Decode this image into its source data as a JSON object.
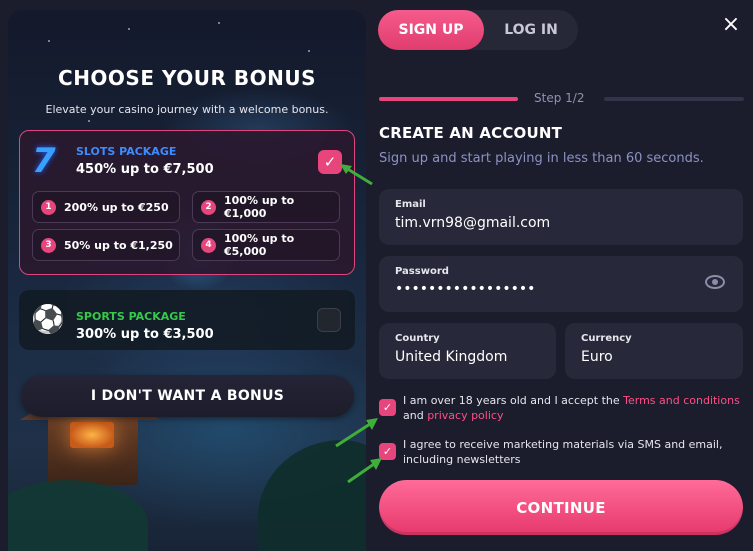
{
  "bonus_panel": {
    "title": "CHOOSE YOUR BONUS",
    "subtitle": "Elevate your casino journey with a welcome bonus.",
    "slots": {
      "icon": "7",
      "name": "SLOTS PACKAGE",
      "offer": "450% up to €7,500",
      "selected": true,
      "tiers": [
        {
          "num": "1",
          "label": "200% up to €250"
        },
        {
          "num": "2",
          "label": "100% up to €1,000"
        },
        {
          "num": "3",
          "label": "50% up to €1,250"
        },
        {
          "num": "4",
          "label": "100% up to €5,000"
        }
      ]
    },
    "sports": {
      "name": "SPORTS PACKAGE",
      "offer": "300% up to €3,500",
      "selected": false
    },
    "no_bonus_label": "I DON'T WANT A BONUS"
  },
  "tabs": {
    "signup": "SIGN UP",
    "login": "LOG IN",
    "active": "signup"
  },
  "close_icon": "×",
  "step": {
    "label": "Step 1/2",
    "current": 1,
    "total": 2
  },
  "form": {
    "title": "CREATE AN ACCOUNT",
    "subtitle": "Sign up and start playing in less than 60 seconds.",
    "email": {
      "label": "Email",
      "value": "tim.vrn98@gmail.com"
    },
    "password": {
      "label": "Password",
      "value": "•••••••••••••••••"
    },
    "country": {
      "label": "Country",
      "value": "United Kingdom"
    },
    "currency": {
      "label": "Currency",
      "value": "Euro"
    },
    "terms": {
      "checked": true,
      "text_before": "I am over 18 years old and I accept the ",
      "terms_link": "Terms and conditions",
      "text_middle": " and ",
      "privacy_link": "privacy policy"
    },
    "marketing": {
      "checked": true,
      "text": "I agree to receive marketing materials via SMS and email, including newsletters"
    },
    "continue_label": "CONTINUE"
  },
  "colors": {
    "accent": "#e8457c",
    "background": "#1b1c2c",
    "field": "#272839",
    "slots_name": "#3d8cff",
    "sports_name": "#36c84a",
    "annotation_arrow": "#3fae3a"
  },
  "icons": {
    "close": "close-icon",
    "eye": "eye-icon",
    "check": "check-icon",
    "slots": "seven-icon",
    "sports": "soccer-ball-icon"
  }
}
